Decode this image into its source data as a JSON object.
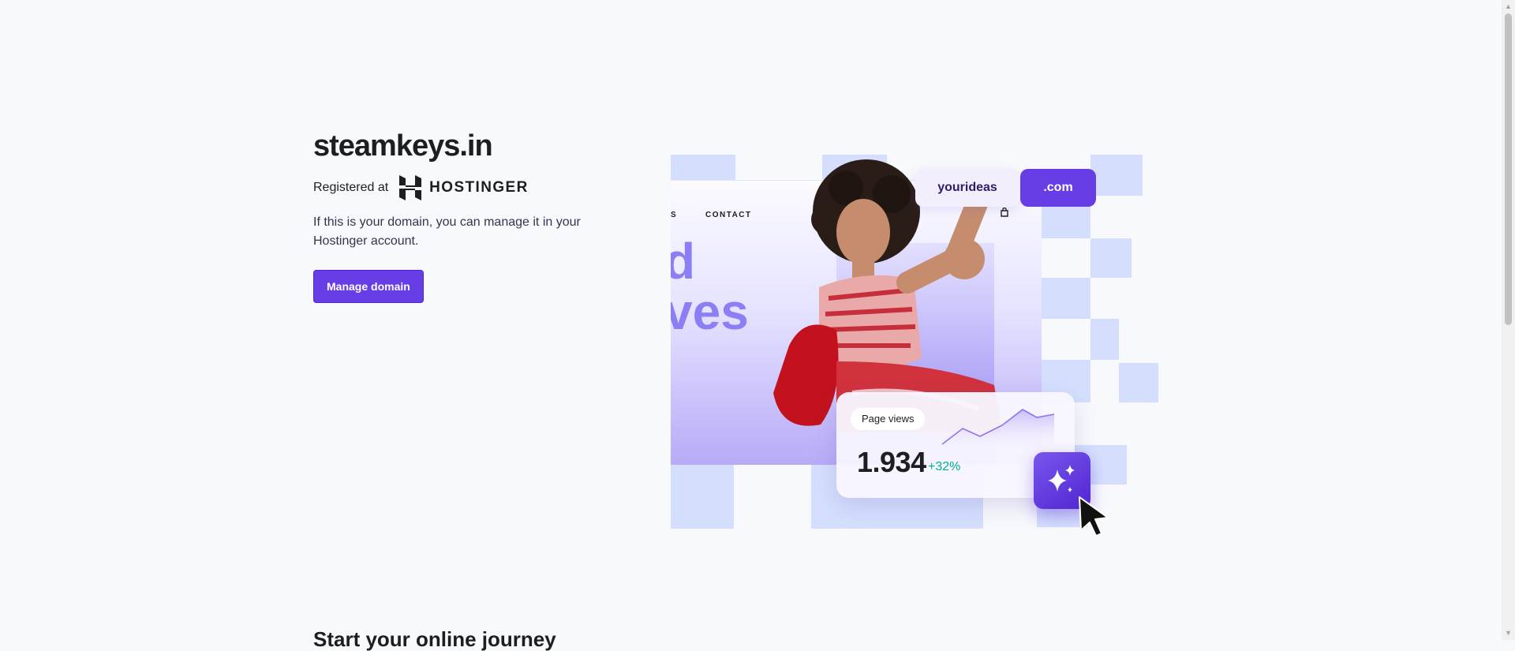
{
  "domain": {
    "name": "steamkeys.in"
  },
  "registration": {
    "label": "Registered at",
    "registrar": "HOSTINGER"
  },
  "description": "If this is your domain, you can manage it in your Hostinger account.",
  "actions": {
    "manage_label": "Manage domain"
  },
  "section": {
    "title": "Start your online journey"
  },
  "hero": {
    "nav_partial": "S",
    "nav_contact": "CONTACT",
    "big_text_line1": "d",
    "big_text_line2": "ves",
    "domain_pill_name": "yourideas",
    "domain_pill_tld": ".com",
    "stats_label": "Page views",
    "stats_value": "1.934",
    "stats_delta": "+32%"
  },
  "colors": {
    "accent": "#673de6",
    "accent_dark": "#5025d1",
    "tile": "#d5dffd",
    "positive": "#00b090"
  },
  "icons": [
    "hostinger-logo-icon",
    "shopping-bag-icon",
    "sparkle-icon",
    "cursor-arrow-icon"
  ]
}
